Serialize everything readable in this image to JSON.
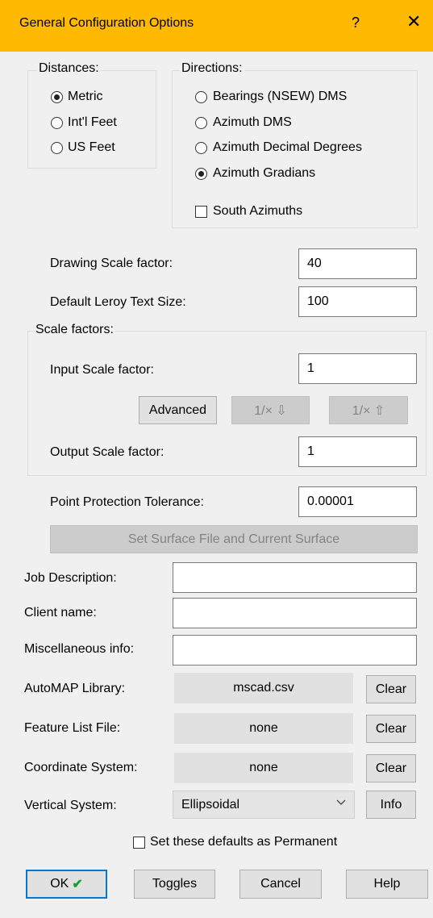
{
  "window": {
    "title": "General Configuration Options",
    "help_glyph": "?",
    "close_glyph": "✕"
  },
  "distances": {
    "label": "Distances:",
    "options": [
      {
        "label": "Metric",
        "selected": true
      },
      {
        "label": "Int'l Feet",
        "selected": false
      },
      {
        "label": "US Feet",
        "selected": false
      }
    ]
  },
  "directions": {
    "label": "Directions:",
    "options": [
      {
        "label": "Bearings (NSEW) DMS",
        "selected": false
      },
      {
        "label": "Azimuth DMS",
        "selected": false
      },
      {
        "label": "Azimuth Decimal Degrees",
        "selected": false
      },
      {
        "label": "Azimuth Gradians",
        "selected": true
      }
    ],
    "south_azimuths": {
      "label": "South Azimuths",
      "checked": false
    }
  },
  "drawing_scale": {
    "label": "Drawing Scale factor:",
    "value": "40"
  },
  "leroy_text": {
    "label": "Default Leroy Text Size:",
    "value": "100"
  },
  "scale_factors": {
    "label": "Scale factors:",
    "input": {
      "label": "Input Scale factor:",
      "value": "1"
    },
    "advanced_label": "Advanced",
    "recip_down_label": "1/×  ⇩",
    "recip_up_label": "1/×  ⇧",
    "output": {
      "label": "Output Scale factor:",
      "value": "1"
    }
  },
  "point_protection": {
    "label": "Point Protection Tolerance:",
    "value": "0.00001"
  },
  "set_surface_label": "Set Surface File and Current Surface",
  "job_description": {
    "label": "Job Description:",
    "value": ""
  },
  "client_name": {
    "label": "Client name:",
    "value": ""
  },
  "misc_info": {
    "label": "Miscellaneous info:",
    "value": ""
  },
  "automap": {
    "label": "AutoMAP Library:",
    "value": "mscad.csv",
    "clear_label": "Clear"
  },
  "feature_list": {
    "label": "Feature List File:",
    "value": "none",
    "clear_label": "Clear"
  },
  "coordinate_system": {
    "label": "Coordinate System:",
    "value": "none",
    "clear_label": "Clear"
  },
  "vertical_system": {
    "label": "Vertical System:",
    "value": "Ellipsoidal",
    "info_label": "Info"
  },
  "permanent": {
    "label": "Set these defaults as Permanent",
    "checked": false
  },
  "buttons": {
    "ok": "OK",
    "ok_mark": "✔",
    "toggles": "Toggles",
    "cancel": "Cancel",
    "help": "Help"
  },
  "colors": {
    "titlebar": "#ffb900",
    "dialog_bg": "#f0f0f0",
    "ok_border": "#0078d7",
    "ok_check": "#1c9f2d"
  }
}
